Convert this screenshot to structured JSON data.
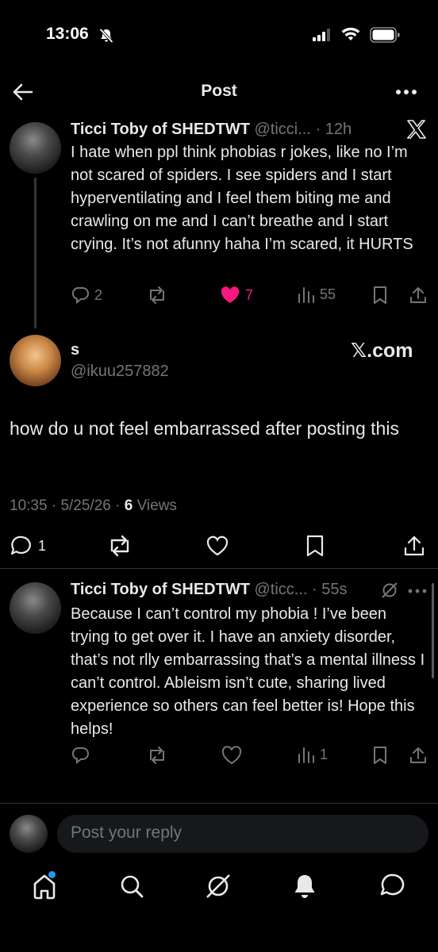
{
  "status_bar": {
    "time": "13:06"
  },
  "header": {
    "title": "Post"
  },
  "thread_tweet": {
    "name": "Ticci Toby of SHEDTWT",
    "handle": "@ticci...",
    "sep": "·",
    "time": "12h",
    "text": "I hate when ppl think phobias r jokes, like no I’m not scared of spiders. I see spiders and I start hyperventilating and I feel them biting me and crawling on me and I can’t breathe and I start crying. It’s not afunny haha I’m scared, it HURTS",
    "replies": "2",
    "likes": "7",
    "views": "55",
    "like_color": "#f91880"
  },
  "main_tweet": {
    "name": "s",
    "handle": "@ikuu257882",
    "source_badge": "𝕏.com",
    "text": "how do u not feel embarrassed after posting this",
    "time": "10:35",
    "sep1": "·",
    "date": "5/25/26",
    "sep2": "·",
    "views_count": "6",
    "views_label": "Views",
    "replies": "1"
  },
  "reply_tweet": {
    "name": "Ticci Toby of SHEDTWT",
    "handle": "@ticc...",
    "sep": "·",
    "time": "55s",
    "text": "Because I can’t control my phobia ! I’ve been trying to get over it.  I have an anxiety disorder, that’s not rlly embarrassing that’s a mental illness I can’t control. Ableism isn’t cute, sharing lived experience so others can feel better is! Hope this helps!",
    "views": "1"
  },
  "reply_composer": {
    "placeholder": "Post your reply"
  },
  "bottom_nav": {
    "items": [
      "home-icon",
      "search-icon",
      "grok-icon",
      "notifications-icon",
      "messages-icon"
    ],
    "accent": "#1d9bf0"
  }
}
